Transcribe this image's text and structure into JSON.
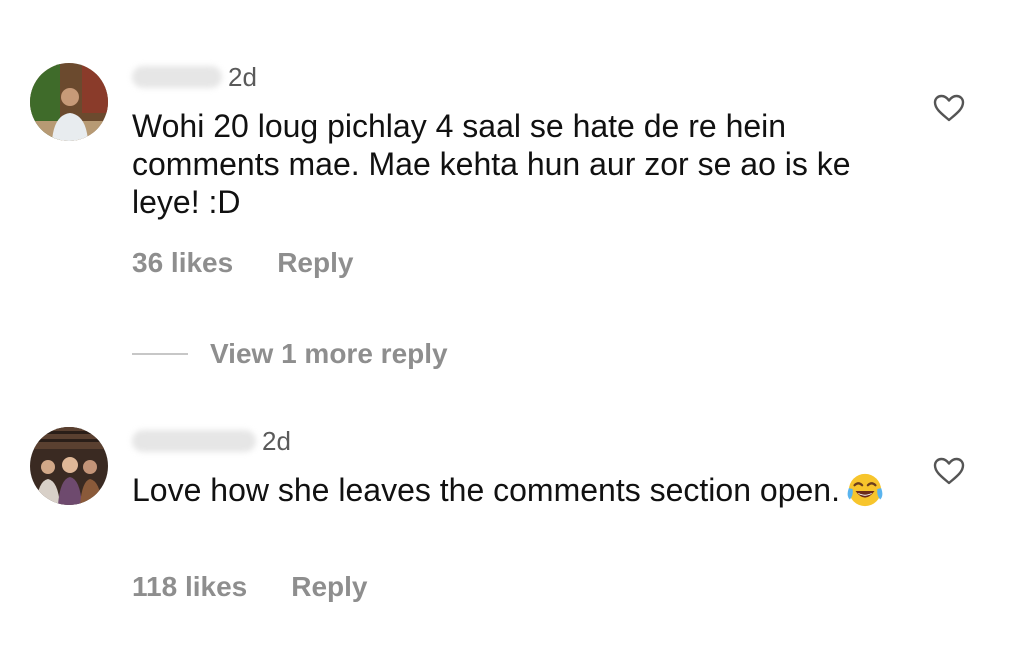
{
  "comments": [
    {
      "time": "2d",
      "text": "Wohi 20 loug pichlay 4 saal se hate de re hein comments mae. Mae kehta hun aur zor se ao is ke leye! :D",
      "likes": "36 likes",
      "reply": "Reply"
    },
    {
      "time": "2d",
      "text": "Love how she leaves the comments section open.",
      "emoji": "face-with-tears-of-joy",
      "likes": "118 likes",
      "reply": "Reply"
    }
  ],
  "view_replies": {
    "label": "View 1 more reply"
  },
  "icons": {
    "like": "heart-outline-icon"
  },
  "colors": {
    "text": "#111111",
    "muted": "#8e8e8e",
    "time": "#5a5a5a",
    "divider": "#c7c7c7"
  }
}
